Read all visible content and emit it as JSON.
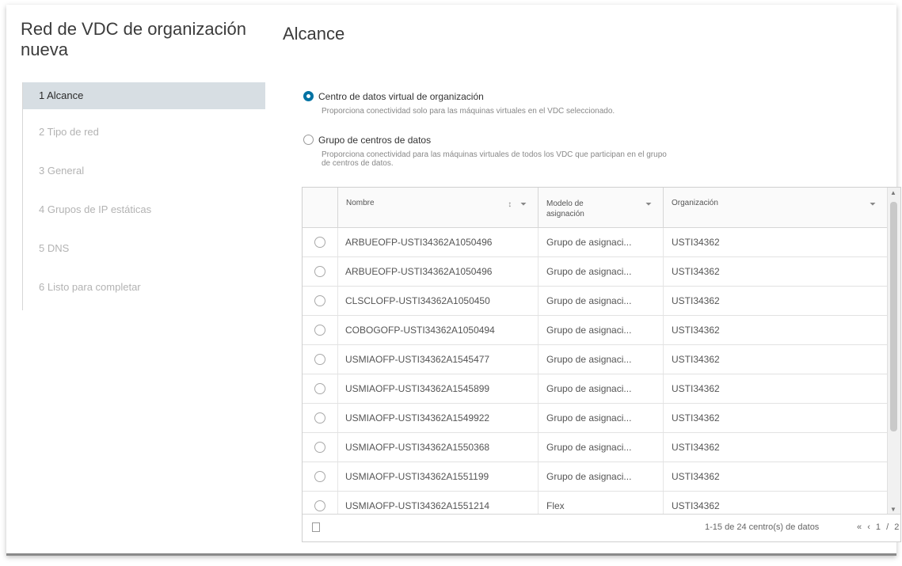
{
  "wizard": {
    "title": "Red de VDC de organización nueva",
    "steps": [
      {
        "label": "1  Alcance"
      },
      {
        "label": "2  Tipo de red"
      },
      {
        "label": "3  General"
      },
      {
        "label": "4  Grupos de IP estáticas"
      },
      {
        "label": "5  DNS"
      },
      {
        "label": "6  Listo para completar"
      }
    ]
  },
  "content": {
    "title": "Alcance",
    "option1": {
      "label": "Centro de datos virtual de organización",
      "description": "Proporciona conectividad solo para las máquinas virtuales en el VDC seleccionado."
    },
    "option2": {
      "label": "Grupo de centros de datos",
      "description": "Proporciona conectividad para las máquinas virtuales de todos los VDC que participan en el grupo de centros de datos."
    }
  },
  "table": {
    "headers": {
      "name": "Nombre",
      "model": "Modelo de asignación",
      "org": "Organización"
    },
    "rows": [
      {
        "name": "ARBUEOFP-USTI34362A1050496",
        "model": "Grupo de asignaci...",
        "org": "USTI34362"
      },
      {
        "name": "ARBUEOFP-USTI34362A1050496",
        "model": "Grupo de asignaci...",
        "org": "USTI34362"
      },
      {
        "name": "CLSCLOFP-USTI34362A1050450",
        "model": "Grupo de asignaci...",
        "org": "USTI34362"
      },
      {
        "name": "COBOGOFP-USTI34362A1050494",
        "model": "Grupo de asignaci...",
        "org": "USTI34362"
      },
      {
        "name": "USMIAOFP-USTI34362A1545477",
        "model": "Grupo de asignaci...",
        "org": "USTI34362"
      },
      {
        "name": "USMIAOFP-USTI34362A1545899",
        "model": "Grupo de asignaci...",
        "org": "USTI34362"
      },
      {
        "name": "USMIAOFP-USTI34362A1549922",
        "model": "Grupo de asignaci...",
        "org": "USTI34362"
      },
      {
        "name": "USMIAOFP-USTI34362A1550368",
        "model": "Grupo de asignaci...",
        "org": "USTI34362"
      },
      {
        "name": "USMIAOFP-USTI34362A1551199",
        "model": "Grupo de asignaci...",
        "org": "USTI34362"
      },
      {
        "name": "USMIAOFP-USTI34362A1551214",
        "model": "Flex",
        "org": "USTI34362"
      }
    ],
    "footer": {
      "count": "1-15 de 24 centro(s) de datos",
      "page": "1 / 2"
    }
  },
  "colors": {
    "accent": "#0072a3",
    "active_step_bg": "#d7dee3"
  }
}
